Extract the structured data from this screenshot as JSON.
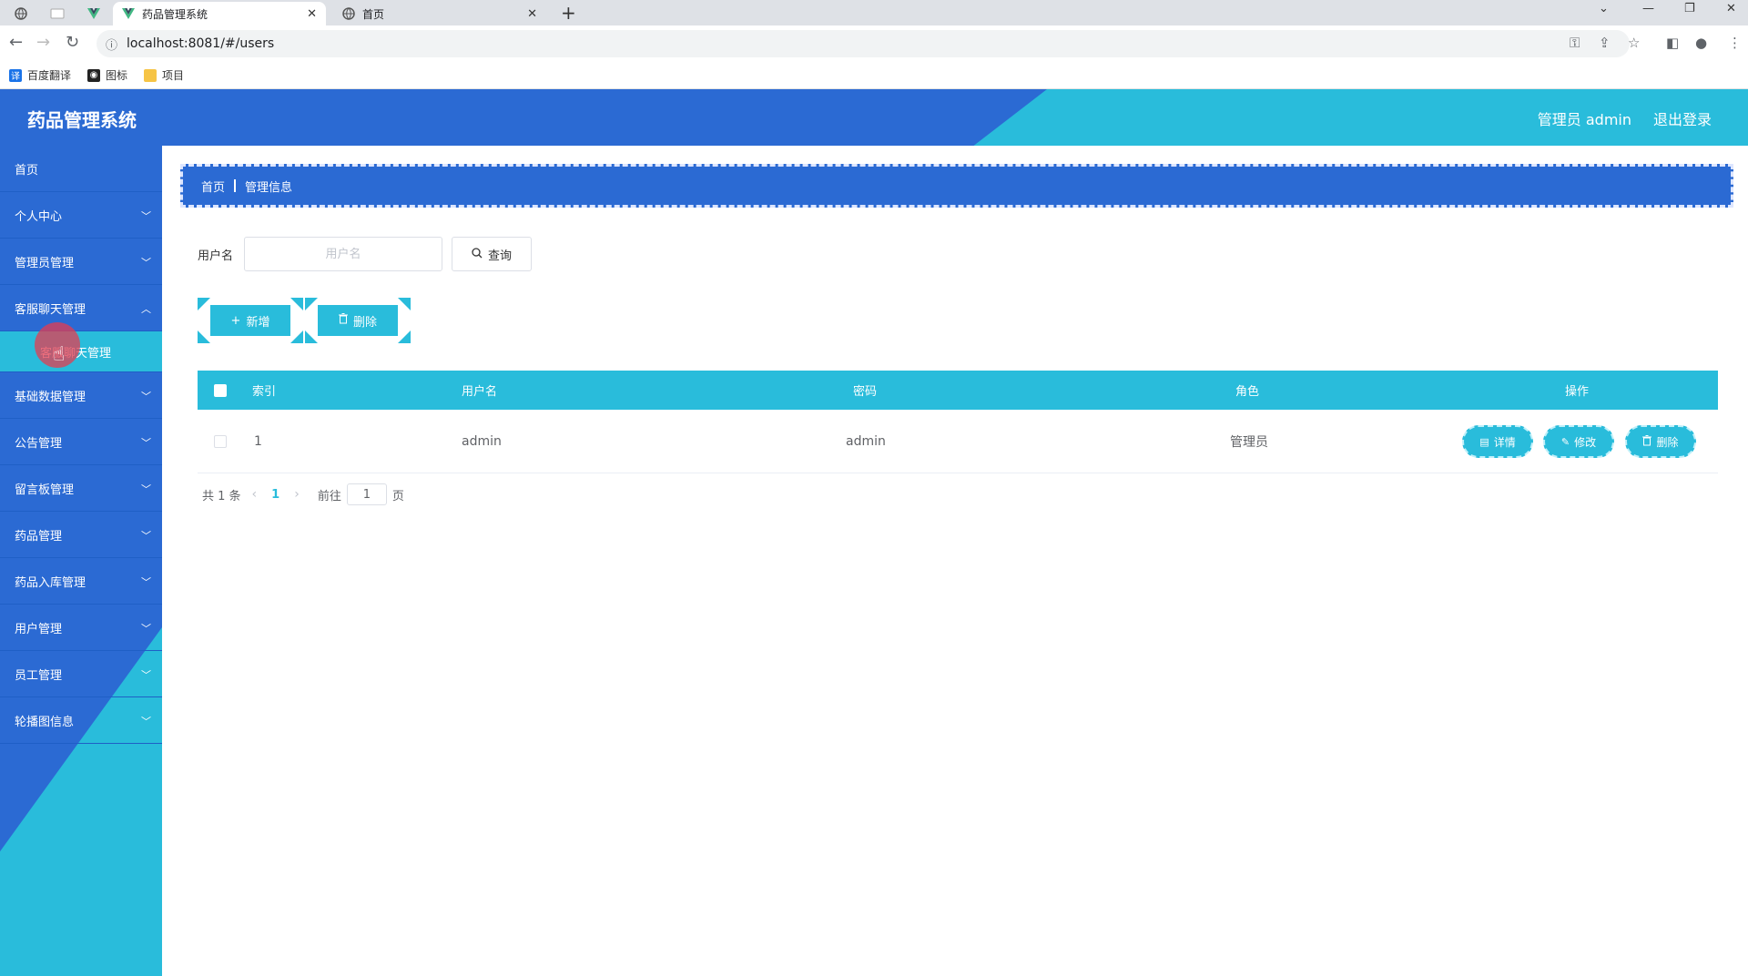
{
  "browser": {
    "tabs": [
      {
        "title": "药品管理系统",
        "active": true
      },
      {
        "title": "首页",
        "active": false
      }
    ],
    "url": "localhost:8081/#/users",
    "bookmarks": [
      {
        "label": "百度翻译",
        "icon": "translate-icon",
        "color": "#1a73e8"
      },
      {
        "label": "图标",
        "icon": "icon-bookmark-icon",
        "color": "#222222"
      },
      {
        "label": "项目",
        "icon": "folder-icon",
        "color": "#f6c445"
      }
    ]
  },
  "header": {
    "title": "药品管理系统",
    "user": "管理员 admin",
    "logout": "退出登录"
  },
  "sidebar": {
    "items": [
      {
        "label": "首页"
      },
      {
        "label": "个人中心"
      },
      {
        "label": "管理员管理"
      },
      {
        "label": "客服聊天管理"
      },
      {
        "label": "基础数据管理"
      },
      {
        "label": "公告管理"
      },
      {
        "label": "留言板管理"
      },
      {
        "label": "药品管理"
      },
      {
        "label": "药品入库管理"
      },
      {
        "label": "用户管理"
      },
      {
        "label": "员工管理"
      },
      {
        "label": "轮播图信息"
      }
    ],
    "sub_item": "客服聊天管理"
  },
  "breadcrumb": {
    "home": "首页",
    "current": "管理信息"
  },
  "search": {
    "label": "用户名",
    "placeholder": "用户名",
    "button": "查询"
  },
  "actions": {
    "add": "新增",
    "delete": "删除"
  },
  "table": {
    "columns": [
      "索引",
      "用户名",
      "密码",
      "角色",
      "操作"
    ],
    "rows": [
      {
        "index": "1",
        "username": "admin",
        "password": "admin",
        "role": "管理员"
      }
    ],
    "ops": {
      "detail": "详情",
      "edit": "修改",
      "delete": "删除"
    }
  },
  "pagination": {
    "total": "共 1 条",
    "current": "1",
    "goto_label": "前往",
    "goto_value": "1",
    "page_suffix": "页"
  },
  "colors": {
    "primary_blue": "#2b6ad3",
    "accent_cyan": "#29bcdb"
  }
}
